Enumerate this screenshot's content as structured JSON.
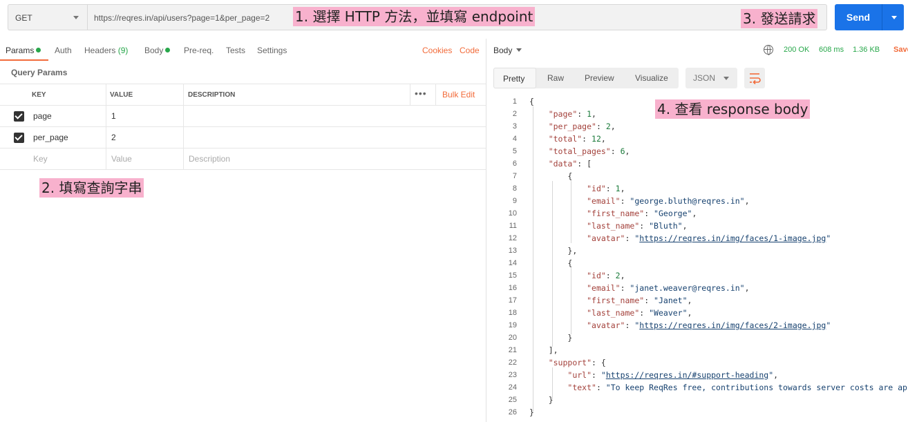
{
  "request": {
    "method": "GET",
    "url": "https://reqres.in/api/users?page=1&per_page=2",
    "send_label": "Send"
  },
  "annotations": {
    "a1": "1. 選擇 HTTP 方法，並填寫 endpoint",
    "a2": "2. 填寫查詢字串",
    "a3": "3. 發送請求",
    "a4": "4. 查看 response body"
  },
  "req_tabs": {
    "params": "Params",
    "auth": "Auth",
    "headers": "Headers",
    "headers_count": "(9)",
    "body": "Body",
    "prereq": "Pre-req.",
    "tests": "Tests",
    "settings": "Settings",
    "cookies": "Cookies",
    "code": "Code"
  },
  "query_params": {
    "title": "Query Params",
    "headers": {
      "key": "KEY",
      "value": "VALUE",
      "description": "DESCRIPTION",
      "bulk_edit": "Bulk Edit"
    },
    "rows": [
      {
        "key": "page",
        "value": "1",
        "checked": true
      },
      {
        "key": "per_page",
        "value": "2",
        "checked": true
      }
    ],
    "placeholders": {
      "key": "Key",
      "value": "Value",
      "description": "Description"
    }
  },
  "response": {
    "body_label": "Body",
    "status": "200 OK",
    "time": "608 ms",
    "size": "1.36 KB",
    "save": "Save",
    "views": [
      "Pretty",
      "Raw",
      "Preview",
      "Visualize"
    ],
    "format": "JSON"
  },
  "code_lines": [
    {
      "n": "1",
      "html": "<span class='p'>{</span>"
    },
    {
      "n": "2",
      "html": "    <span class='k'>\"page\"</span><span class='p'>: </span><span class='n'>1</span><span class='p'>,</span>"
    },
    {
      "n": "3",
      "html": "    <span class='k'>\"per_page\"</span><span class='p'>: </span><span class='n'>2</span><span class='p'>,</span>"
    },
    {
      "n": "4",
      "html": "    <span class='k'>\"total\"</span><span class='p'>: </span><span class='n'>12</span><span class='p'>,</span>"
    },
    {
      "n": "5",
      "html": "    <span class='k'>\"total_pages\"</span><span class='p'>: </span><span class='n'>6</span><span class='p'>,</span>"
    },
    {
      "n": "6",
      "html": "    <span class='k'>\"data\"</span><span class='p'>: [</span>"
    },
    {
      "n": "7",
      "html": "        <span class='p'>{</span>"
    },
    {
      "n": "8",
      "html": "            <span class='k'>\"id\"</span><span class='p'>: </span><span class='n'>1</span><span class='p'>,</span>"
    },
    {
      "n": "9",
      "html": "            <span class='k'>\"email\"</span><span class='p'>: </span><span class='s'>\"george.bluth@reqres.in\"</span><span class='p'>,</span>"
    },
    {
      "n": "10",
      "html": "            <span class='k'>\"first_name\"</span><span class='p'>: </span><span class='s'>\"George\"</span><span class='p'>,</span>"
    },
    {
      "n": "11",
      "html": "            <span class='k'>\"last_name\"</span><span class='p'>: </span><span class='s'>\"Bluth\"</span><span class='p'>,</span>"
    },
    {
      "n": "12",
      "html": "            <span class='k'>\"avatar\"</span><span class='p'>: </span><span class='s'>\"</span><span class='u'>https://reqres.in/img/faces/1-image.jpg</span><span class='s'>\"</span>"
    },
    {
      "n": "13",
      "html": "        <span class='p'>},</span>"
    },
    {
      "n": "14",
      "html": "        <span class='p'>{</span>"
    },
    {
      "n": "15",
      "html": "            <span class='k'>\"id\"</span><span class='p'>: </span><span class='n'>2</span><span class='p'>,</span>"
    },
    {
      "n": "16",
      "html": "            <span class='k'>\"email\"</span><span class='p'>: </span><span class='s'>\"janet.weaver@reqres.in\"</span><span class='p'>,</span>"
    },
    {
      "n": "17",
      "html": "            <span class='k'>\"first_name\"</span><span class='p'>: </span><span class='s'>\"Janet\"</span><span class='p'>,</span>"
    },
    {
      "n": "18",
      "html": "            <span class='k'>\"last_name\"</span><span class='p'>: </span><span class='s'>\"Weaver\"</span><span class='p'>,</span>"
    },
    {
      "n": "19",
      "html": "            <span class='k'>\"avatar\"</span><span class='p'>: </span><span class='s'>\"</span><span class='u'>https://reqres.in/img/faces/2-image.jpg</span><span class='s'>\"</span>"
    },
    {
      "n": "20",
      "html": "        <span class='p'>}</span>"
    },
    {
      "n": "21",
      "html": "    <span class='p'>],</span>"
    },
    {
      "n": "22",
      "html": "    <span class='k'>\"support\"</span><span class='p'>: {</span>"
    },
    {
      "n": "23",
      "html": "        <span class='k'>\"url\"</span><span class='p'>: </span><span class='s'>\"</span><span class='u'>https://reqres.in/#support-heading</span><span class='s'>\"</span><span class='p'>,</span>"
    },
    {
      "n": "24",
      "html": "        <span class='k'>\"text\"</span><span class='p'>: </span><span class='s'>\"To keep ReqRes free, contributions towards server costs are apprec</span>"
    },
    {
      "n": "25",
      "html": "    <span class='p'>}</span>"
    },
    {
      "n": "26",
      "html": "<span class='p'>}</span>"
    }
  ]
}
